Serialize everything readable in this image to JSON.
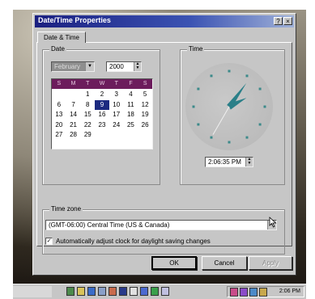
{
  "window": {
    "title": "Date/Time Properties",
    "help_button": "?",
    "close_button": "×"
  },
  "tabs": [
    {
      "label": "Date & Time"
    }
  ],
  "date_group": {
    "label": "Date",
    "month": "February",
    "year": "2000",
    "day_headers": [
      "S",
      "M",
      "T",
      "W",
      "T",
      "F",
      "S"
    ],
    "weeks": [
      [
        "",
        "",
        "1",
        "2",
        "3",
        "4",
        "5"
      ],
      [
        "6",
        "7",
        "8",
        "9",
        "10",
        "11",
        "12"
      ],
      [
        "13",
        "14",
        "15",
        "16",
        "17",
        "18",
        "19"
      ],
      [
        "20",
        "21",
        "22",
        "23",
        "24",
        "25",
        "26"
      ],
      [
        "27",
        "28",
        "29",
        "",
        "",
        "",
        ""
      ]
    ],
    "selected_day": "9"
  },
  "time_group": {
    "label": "Time",
    "time_value": "2:06:35 PM",
    "hands": {
      "hour": 14.1,
      "minute": 6,
      "second": 35
    }
  },
  "timezone_group": {
    "label": "Time zone",
    "value": "(GMT-06:00) Central Time (US & Canada)",
    "dst_checked": true,
    "dst_label": "Automatically adjust clock for daylight saving changes"
  },
  "buttons": {
    "ok": "OK",
    "cancel": "Cancel",
    "apply": "Apply"
  },
  "taskbar": {
    "clock": "2:06 PM"
  },
  "colors": {
    "calendar_header": "#6c1c5c",
    "clock_hand": "#2a7f88",
    "titlebar": "#1a1f80"
  }
}
